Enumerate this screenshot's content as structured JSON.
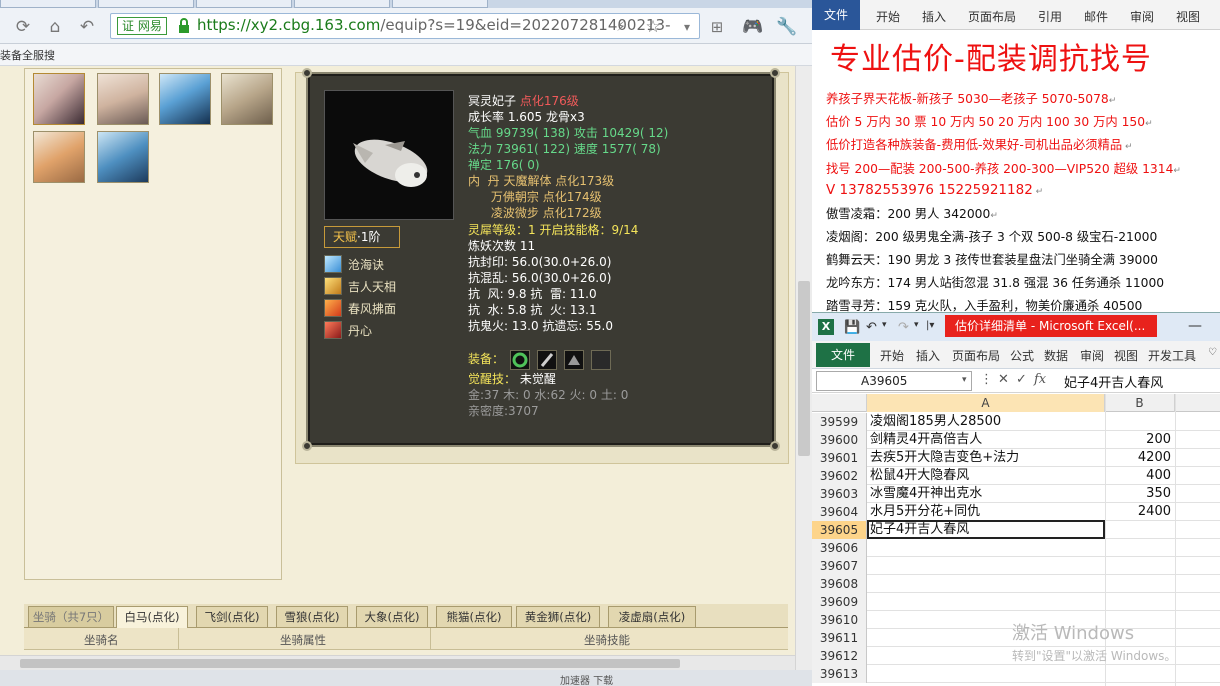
{
  "browser": {
    "tabs": [
      "",
      "",
      "",
      "",
      ""
    ],
    "cert_label": "证 网易",
    "url_host": "https://xy2.cbg.163.com",
    "url_rest": "/equip?s=19&eid=202207281400213-",
    "bookmark": "装备全服搜",
    "status_text": "加速器  下载"
  },
  "tooltip": {
    "name": "冥灵妃子",
    "name_tag": "点化176级",
    "growth": "成长率 1.605 龙骨x3",
    "stat1": "气血 99739( 138) 攻击 10429( 12)",
    "stat2": "法力 73961( 122) 速度 1577( 78)",
    "stat3": "禅定 176( 0)",
    "neidan1": "内  丹 天魔解体 点化173级",
    "neidan2": "      万佛朝宗 点化174级",
    "neidan3": "      凌波微步 点化172级",
    "lingxi": "灵犀等级：1 开启技能格：9/14",
    "lianyao": "炼妖次数 11",
    "res1": "抗封印: 56.0(30.0+26.0)",
    "res2": "抗混乱: 56.0(30.0+26.0)",
    "res3": "抗  风: 9.8 抗  雷: 11.0",
    "res4": "抗  水: 5.8 抗  火: 13.1",
    "res5": "抗鬼火: 13.0 抗遗忘: 55.0",
    "equip_label": "装备：",
    "awaken_label": "觉醒技：",
    "awaken_value": "未觉醒",
    "elements": "金:37 木: 0 水:62 火: 0 土: 0",
    "intimacy": "亲密度:3707",
    "talent_label": "天赋",
    "talent_level": "·1阶",
    "skills": [
      "沧海诀",
      "吉人天相",
      "春风拂面",
      "丹心"
    ]
  },
  "mounts": {
    "tabs": [
      "坐骑（共7只）",
      "白马(点化)",
      "飞剑(点化)",
      "雪狼(点化)",
      "大象(点化)",
      "熊猫(点化)",
      "黄金狮(点化)",
      "凌虚扇(点化)"
    ],
    "headers": [
      "坐骑名",
      "坐骑属性",
      "坐骑技能"
    ]
  },
  "word": {
    "tabs": [
      "文件",
      "开始",
      "插入",
      "页面布局",
      "引用",
      "邮件",
      "审阅",
      "视图"
    ],
    "heading": "专业估价-配装调抗找号",
    "lines": [
      "养孩子界天花板-新孩子 5030—老孩子 5070-5078",
      "估价 5 万内 30 票   10 万内 50  20 万内 100  30 万内 150",
      "低价打造各种族装备-费用低-效果好-司机出品必须精品",
      "找号 200—配装 200-500-养孩 200-300—VIP520 超级 1314",
      "V      13782553976      15225921182",
      "傲雪凌霜：200 男人 342000",
      "凌烟阁：200 级男鬼全满-孩子 3 个双 500-8 级宝石-21000",
      "鹤舞云天：190 男龙 3 孩传世套装星盘法门坐骑全满 39000",
      "龙吟东方：174 男人站街忽混 31.8 强混 36 任务通杀 11000",
      "踏雪寻芳：159 克火队，入手盈利，物美价廉通杀 40500"
    ]
  },
  "excel": {
    "title": "估价详细清单 - Microsoft Excel(...",
    "tabs": [
      "文件",
      "开始",
      "插入",
      "页面布局",
      "公式",
      "数据",
      "审阅",
      "视图",
      "开发工具"
    ],
    "name_box": "A39605",
    "formula": "妃子4开吉人春风",
    "col_a": "A",
    "col_b": "B",
    "rows": [
      {
        "n": "39599",
        "a": "凌烟阁185男人28500",
        "b": ""
      },
      {
        "n": "39600",
        "a": "剑精灵4开高倍吉人",
        "b": "200"
      },
      {
        "n": "39601",
        "a": "去疾5开大隐吉变色+法力",
        "b": "4200"
      },
      {
        "n": "39602",
        "a": "松鼠4开大隐春风",
        "b": "400"
      },
      {
        "n": "39603",
        "a": "冰雪魔4开神出克水",
        "b": "350"
      },
      {
        "n": "39604",
        "a": "水月5开分花+同仇",
        "b": "2400"
      },
      {
        "n": "39605",
        "a": "妃子4开吉人春风",
        "b": ""
      },
      {
        "n": "39606",
        "a": "",
        "b": ""
      },
      {
        "n": "39607",
        "a": "",
        "b": ""
      },
      {
        "n": "39608",
        "a": "",
        "b": ""
      },
      {
        "n": "39609",
        "a": "",
        "b": ""
      },
      {
        "n": "39610",
        "a": "",
        "b": ""
      },
      {
        "n": "39611",
        "a": "",
        "b": ""
      },
      {
        "n": "39612",
        "a": "",
        "b": ""
      },
      {
        "n": "39613",
        "a": "",
        "b": ""
      }
    ],
    "watermark_title": "激活 Windows",
    "watermark_sub": "转到\"设置\"以激活 Windows。"
  }
}
